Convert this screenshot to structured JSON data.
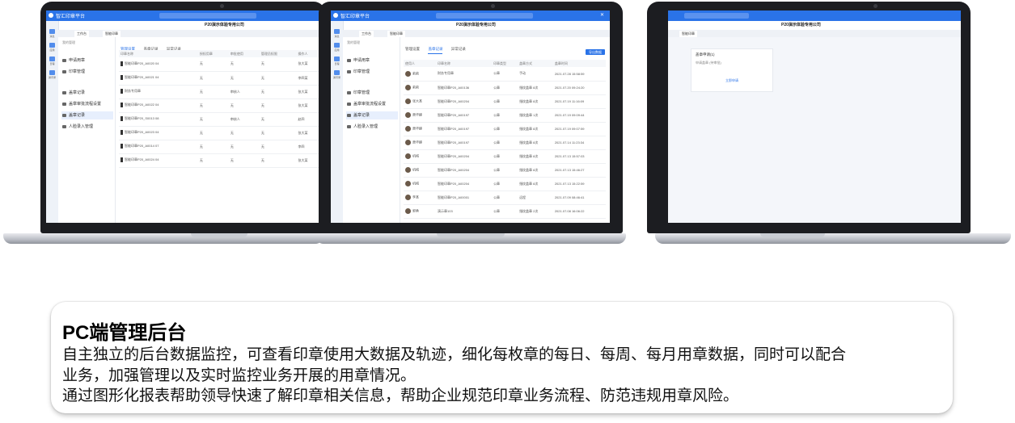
{
  "app": {
    "window_title": "智汇印章平台",
    "company": "P20演示体验专用公司",
    "home_tab": "工作台"
  },
  "sidebar": {
    "items": [
      "消息",
      "应用",
      "日程",
      "通讯录"
    ]
  },
  "nav": {
    "section_manage": "我的管理",
    "items": [
      "申请用章",
      "印章管理",
      "盖章记录",
      "盖章审批流程设置",
      "人脸录入管理"
    ]
  },
  "left_screen": {
    "tab": "智能印章",
    "subtabs": [
      "管理设置",
      "盖章记录",
      "异常记录"
    ],
    "columns": [
      "印章名称",
      "授权用章",
      "审批使用",
      "管理员权限",
      "操作人"
    ],
    "rows": [
      [
        "智能印章P20_A0020 04",
        "无",
        "无",
        "无",
        "张大某"
      ],
      [
        "智能印章P20_A0021 04",
        "无",
        "无",
        "无",
        "李四某"
      ],
      [
        "财务专用章",
        "无",
        "审核人",
        "无",
        "张大某"
      ],
      [
        "智能印章P20_A0022 04",
        "无",
        "无",
        "无",
        "张大某"
      ],
      [
        "智能印章P20_S0013 08",
        "无",
        "审核人",
        "无",
        "赵四"
      ],
      [
        "智能印章P20_A0023 04",
        "无",
        "无",
        "无",
        "张大某"
      ],
      [
        "智能印章P20_A0014 07",
        "无",
        "无",
        "无",
        "李四"
      ],
      [
        "智能印章P20_A0024 04",
        "无",
        "无",
        "无",
        "张大某"
      ]
    ]
  },
  "center_screen": {
    "tab": "智能印章",
    "subtabs": [
      "管理设置",
      "盖章记录",
      "异常记录"
    ],
    "export_button": "导出数据",
    "columns": [
      "使用人",
      "印章名称",
      "印章类型",
      "盖章方式",
      "盖章时间"
    ],
    "rows": [
      [
        "莉莉",
        "财务专用章",
        "公章",
        "手动",
        "2021.07.28 15:58:59"
      ],
      [
        "莉莉",
        "智能印章P20_A00136",
        "公章",
        "指纹盖章 8次",
        "2021.07.20 09:24:20"
      ],
      [
        "张大某",
        "智能印章P20_A00204",
        "公章",
        "指纹盖章 8次",
        "2021.07.19 11:16:09"
      ],
      [
        "萧华峰",
        "智能印章P20_A00197",
        "公章",
        "指纹盖章 1次",
        "2021.07.19 09:09:44"
      ],
      [
        "萧华峰",
        "智能印章P20_A00197",
        "公章",
        "指纹盖章 8次",
        "2021.07.19 09:07:59"
      ],
      [
        "萧华峰",
        "智能印章P20_A00197",
        "公章",
        "指纹盖章 8次",
        "2021.07.14 11:23:34"
      ],
      [
        "机械",
        "智能印章P20_A00204",
        "公章",
        "指纹盖章 8次",
        "2021.07.13 15:57:03"
      ],
      [
        "机械",
        "智能印章P20_A00204",
        "公章",
        "指纹盖章 8次",
        "2021.07.13 15:46:27"
      ],
      [
        "机械",
        "智能印章P20_A00204",
        "公章",
        "指纹盖章 8次",
        "2021.07.13 15:22:59"
      ],
      [
        "李某",
        "智能印章P20_A00001",
        "公章",
        "远程",
        "2021.07.09 08:46:41"
      ],
      [
        "郭勇",
        "演示章103",
        "公章",
        "指纹盖章 2次",
        "2021.07.08 16:06:22"
      ]
    ]
  },
  "right_screen": {
    "tab": "智能印章",
    "card_title": "盖章申请(1)",
    "card_item": "申请盖章 (待审批)",
    "card_link": "立即申请"
  },
  "infobox": {
    "title": "PC端管理后台",
    "lines": [
      "自主独立的后台数据监控，可查看印章使用大数据及轨迹，细化每枚章的每日、每周、每月用章数据，同时可以配合",
      "业务，加强管理以及实时监控业务开展的用章情况。",
      "通过图形化报表帮助领导快速了解印章相关信息，帮助企业规范印章业务流程、防范违规用章风险。"
    ]
  },
  "colors": {
    "accent": "#2a73e8",
    "bezel": "#1c1d21",
    "aluminum": "#b9bcc4"
  }
}
